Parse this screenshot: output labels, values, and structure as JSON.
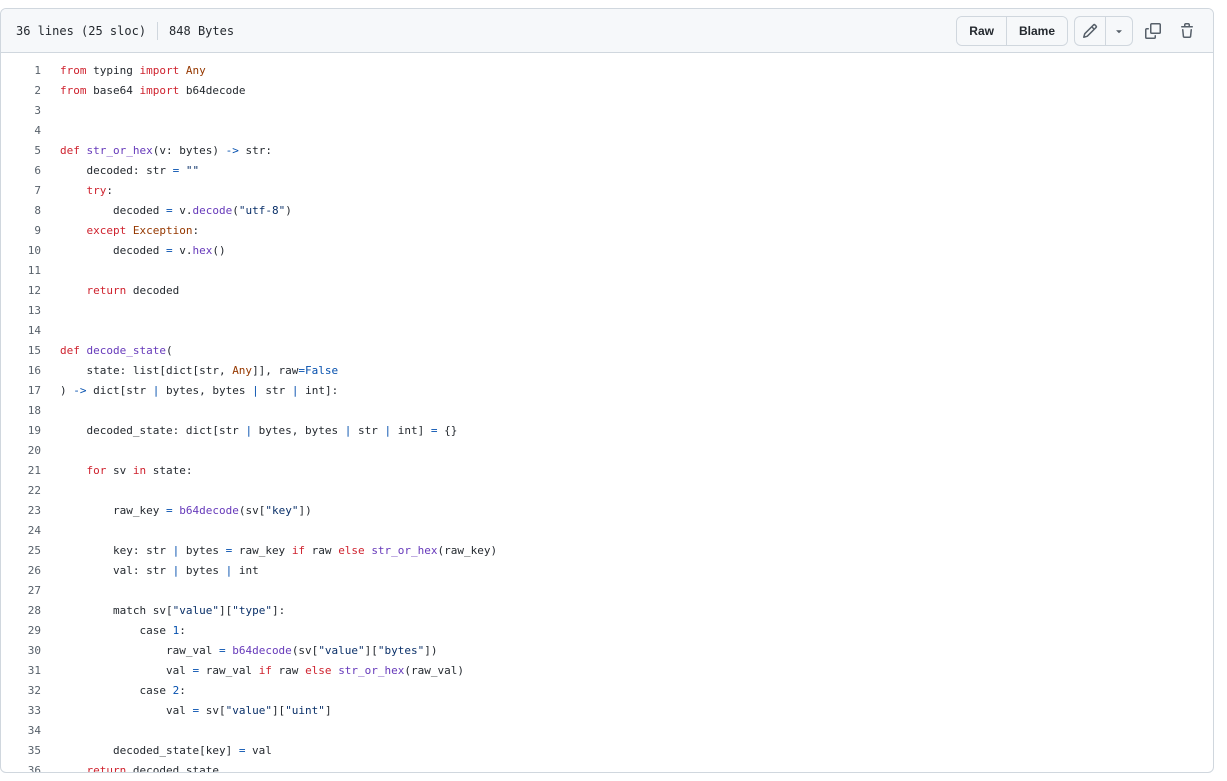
{
  "file": {
    "lines_info": "36 lines (25 sloc)",
    "size": "848 Bytes"
  },
  "toolbar": {
    "raw_label": "Raw",
    "blame_label": "Blame",
    "icons": [
      "pencil-icon",
      "triangle-down-icon",
      "copy-icon",
      "trash-icon"
    ]
  },
  "colors": {
    "keyword": "#cf222e",
    "function": "#6639ba",
    "constant": "#0550ae",
    "string": "#0a3069",
    "type": "#953800",
    "line_number": "#57606a"
  },
  "code_lines": [
    [
      {
        "t": "from",
        "c": "k"
      },
      {
        "t": " typing "
      },
      {
        "t": "import",
        "c": "k"
      },
      {
        "t": " "
      },
      {
        "t": "Any",
        "c": "t"
      }
    ],
    [
      {
        "t": "from",
        "c": "k"
      },
      {
        "t": " base64 "
      },
      {
        "t": "import",
        "c": "k"
      },
      {
        "t": " b64decode"
      }
    ],
    [],
    [],
    [
      {
        "t": "def",
        "c": "k"
      },
      {
        "t": " "
      },
      {
        "t": "str_or_hex",
        "c": "f"
      },
      {
        "t": "(v: bytes) "
      },
      {
        "t": "->",
        "c": "c"
      },
      {
        "t": " str:"
      }
    ],
    [
      {
        "t": "    decoded: str "
      },
      {
        "t": "=",
        "c": "c"
      },
      {
        "t": " "
      },
      {
        "t": "\"\"",
        "c": "s"
      }
    ],
    [
      {
        "t": "    "
      },
      {
        "t": "try",
        "c": "k"
      },
      {
        "t": ":"
      }
    ],
    [
      {
        "t": "        decoded "
      },
      {
        "t": "=",
        "c": "c"
      },
      {
        "t": " v."
      },
      {
        "t": "decode",
        "c": "f"
      },
      {
        "t": "("
      },
      {
        "t": "\"utf-8\"",
        "c": "s"
      },
      {
        "t": ")"
      }
    ],
    [
      {
        "t": "    "
      },
      {
        "t": "except",
        "c": "k"
      },
      {
        "t": " "
      },
      {
        "t": "Exception",
        "c": "t"
      },
      {
        "t": ":"
      }
    ],
    [
      {
        "t": "        decoded "
      },
      {
        "t": "=",
        "c": "c"
      },
      {
        "t": " v."
      },
      {
        "t": "hex",
        "c": "f"
      },
      {
        "t": "()"
      }
    ],
    [],
    [
      {
        "t": "    "
      },
      {
        "t": "return",
        "c": "k"
      },
      {
        "t": " decoded"
      }
    ],
    [],
    [],
    [
      {
        "t": "def",
        "c": "k"
      },
      {
        "t": " "
      },
      {
        "t": "decode_state",
        "c": "f"
      },
      {
        "t": "("
      }
    ],
    [
      {
        "t": "    state: list[dict[str, "
      },
      {
        "t": "Any",
        "c": "t"
      },
      {
        "t": "]], raw"
      },
      {
        "t": "=",
        "c": "c"
      },
      {
        "t": "False",
        "c": "c"
      }
    ],
    [
      {
        "t": ") "
      },
      {
        "t": "->",
        "c": "c"
      },
      {
        "t": " dict[str "
      },
      {
        "t": "|",
        "c": "c"
      },
      {
        "t": " bytes, bytes "
      },
      {
        "t": "|",
        "c": "c"
      },
      {
        "t": " str "
      },
      {
        "t": "|",
        "c": "c"
      },
      {
        "t": " int]:"
      }
    ],
    [],
    [
      {
        "t": "    decoded_state: dict[str "
      },
      {
        "t": "|",
        "c": "c"
      },
      {
        "t": " bytes, bytes "
      },
      {
        "t": "|",
        "c": "c"
      },
      {
        "t": " str "
      },
      {
        "t": "|",
        "c": "c"
      },
      {
        "t": " int] "
      },
      {
        "t": "=",
        "c": "c"
      },
      {
        "t": " {}"
      }
    ],
    [],
    [
      {
        "t": "    "
      },
      {
        "t": "for",
        "c": "k"
      },
      {
        "t": " sv "
      },
      {
        "t": "in",
        "c": "k"
      },
      {
        "t": " state:"
      }
    ],
    [],
    [
      {
        "t": "        raw_key "
      },
      {
        "t": "=",
        "c": "c"
      },
      {
        "t": " "
      },
      {
        "t": "b64decode",
        "c": "f"
      },
      {
        "t": "(sv["
      },
      {
        "t": "\"key\"",
        "c": "s"
      },
      {
        "t": "])"
      }
    ],
    [],
    [
      {
        "t": "        key: str "
      },
      {
        "t": "|",
        "c": "c"
      },
      {
        "t": " bytes "
      },
      {
        "t": "=",
        "c": "c"
      },
      {
        "t": " raw_key "
      },
      {
        "t": "if",
        "c": "k"
      },
      {
        "t": " raw "
      },
      {
        "t": "else",
        "c": "k"
      },
      {
        "t": " "
      },
      {
        "t": "str_or_hex",
        "c": "f"
      },
      {
        "t": "(raw_key)"
      }
    ],
    [
      {
        "t": "        val: str "
      },
      {
        "t": "|",
        "c": "c"
      },
      {
        "t": " bytes "
      },
      {
        "t": "|",
        "c": "c"
      },
      {
        "t": " int"
      }
    ],
    [],
    [
      {
        "t": "        match sv["
      },
      {
        "t": "\"value\"",
        "c": "s"
      },
      {
        "t": "]["
      },
      {
        "t": "\"type\"",
        "c": "s"
      },
      {
        "t": "]:"
      }
    ],
    [
      {
        "t": "            case "
      },
      {
        "t": "1",
        "c": "c"
      },
      {
        "t": ":"
      }
    ],
    [
      {
        "t": "                raw_val "
      },
      {
        "t": "=",
        "c": "c"
      },
      {
        "t": " "
      },
      {
        "t": "b64decode",
        "c": "f"
      },
      {
        "t": "(sv["
      },
      {
        "t": "\"value\"",
        "c": "s"
      },
      {
        "t": "]["
      },
      {
        "t": "\"bytes\"",
        "c": "s"
      },
      {
        "t": "])"
      }
    ],
    [
      {
        "t": "                val "
      },
      {
        "t": "=",
        "c": "c"
      },
      {
        "t": " raw_val "
      },
      {
        "t": "if",
        "c": "k"
      },
      {
        "t": " raw "
      },
      {
        "t": "else",
        "c": "k"
      },
      {
        "t": " "
      },
      {
        "t": "str_or_hex",
        "c": "f"
      },
      {
        "t": "(raw_val)"
      }
    ],
    [
      {
        "t": "            case "
      },
      {
        "t": "2",
        "c": "c"
      },
      {
        "t": ":"
      }
    ],
    [
      {
        "t": "                val "
      },
      {
        "t": "=",
        "c": "c"
      },
      {
        "t": " sv["
      },
      {
        "t": "\"value\"",
        "c": "s"
      },
      {
        "t": "]["
      },
      {
        "t": "\"uint\"",
        "c": "s"
      },
      {
        "t": "]"
      }
    ],
    [],
    [
      {
        "t": "        decoded_state[key] "
      },
      {
        "t": "=",
        "c": "c"
      },
      {
        "t": " val"
      }
    ],
    [
      {
        "t": "    "
      },
      {
        "t": "return",
        "c": "k"
      },
      {
        "t": " decoded_state"
      }
    ]
  ]
}
